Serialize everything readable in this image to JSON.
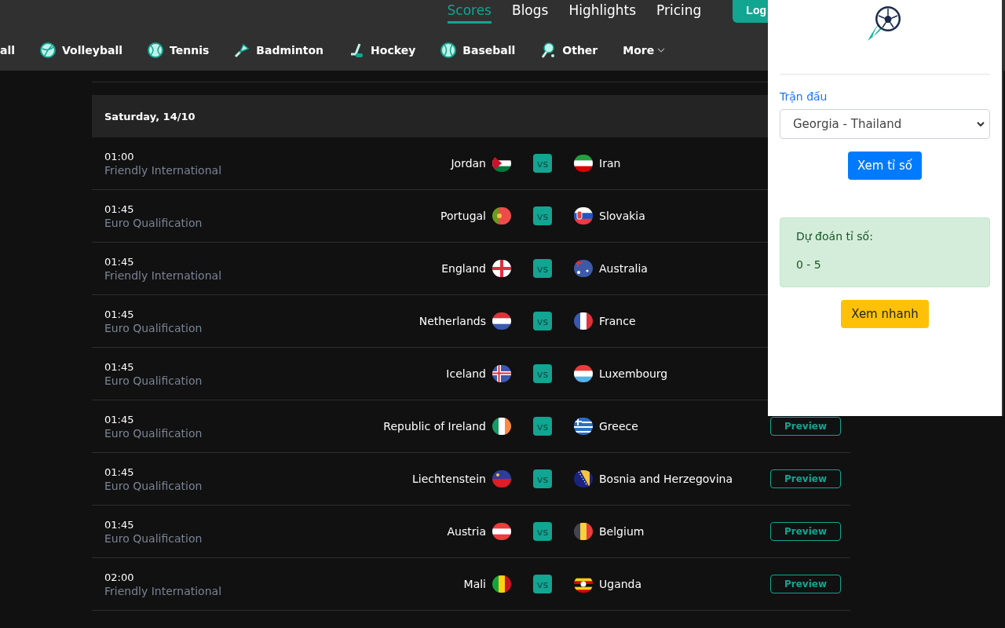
{
  "nav": {
    "links": [
      {
        "label": "Scores",
        "selected": true
      },
      {
        "label": "Blogs",
        "selected": false
      },
      {
        "label": "Highlights",
        "selected": false
      },
      {
        "label": "Pricing",
        "selected": false
      }
    ],
    "login": "Log"
  },
  "sports": [
    {
      "label": "all"
    },
    {
      "label": "Volleyball"
    },
    {
      "label": "Tennis"
    },
    {
      "label": "Badminton"
    },
    {
      "label": "Hockey"
    },
    {
      "label": "Baseball"
    },
    {
      "label": "Other"
    },
    {
      "label": "More",
      "kind": "dropdown"
    }
  ],
  "matches": {
    "date": "Saturday, 14/10",
    "rows": [
      {
        "time": "01:00",
        "competition": "Friendly International",
        "home": "Jordan",
        "vs": "vs",
        "away": "Iran"
      },
      {
        "time": "01:45",
        "competition": "Euro Qualification",
        "home": "Portugal",
        "vs": "vs",
        "away": "Slovakia"
      },
      {
        "time": "01:45",
        "competition": "Friendly International",
        "home": "England",
        "vs": "vs",
        "away": "Australia"
      },
      {
        "time": "01:45",
        "competition": "Euro Qualification",
        "home": "Netherlands",
        "vs": "vs",
        "away": "France"
      },
      {
        "time": "01:45",
        "competition": "Euro Qualification",
        "home": "Iceland",
        "vs": "vs",
        "away": "Luxembourg"
      },
      {
        "time": "01:45",
        "competition": "Euro Qualification",
        "home": "Republic of Ireland",
        "vs": "vs",
        "away": "Greece",
        "action": "Preview"
      },
      {
        "time": "01:45",
        "competition": "Euro Qualification",
        "home": "Liechtenstein",
        "vs": "vs",
        "away": "Bosnia and Herzegovina",
        "action": "Preview"
      },
      {
        "time": "01:45",
        "competition": "Euro Qualification",
        "home": "Austria",
        "vs": "vs",
        "away": "Belgium",
        "action": "Preview"
      },
      {
        "time": "02:00",
        "competition": "Friendly International",
        "home": "Mali",
        "vs": "vs",
        "away": "Uganda",
        "action": "Preview"
      }
    ]
  },
  "popup": {
    "label": "Trận đấu",
    "match_select": "Georgia - Thailand",
    "score_button": "Xem tỉ số",
    "prediction_title": "Dự đoán tỉ số:",
    "prediction": "0 - 5",
    "quick_button": "Xem nhanh"
  }
}
